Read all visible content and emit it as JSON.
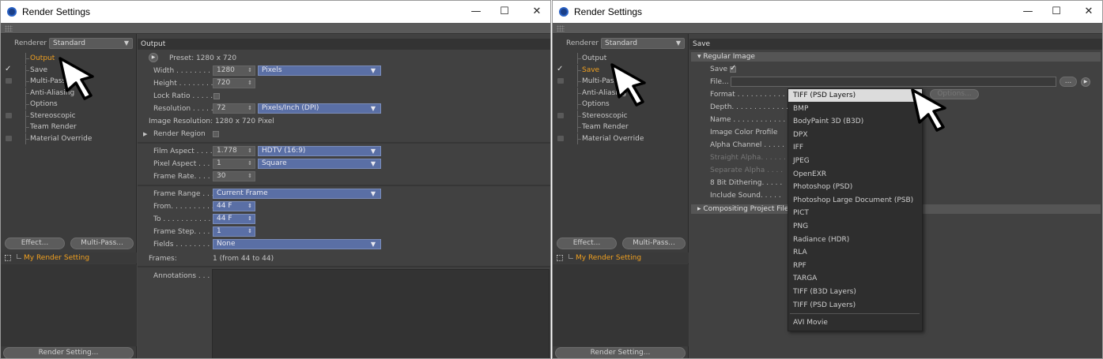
{
  "left_window": {
    "title": "Render Settings",
    "controls": {
      "minimize": "—",
      "maximize": "☐",
      "close": "✕"
    },
    "renderer_label": "Renderer",
    "renderer_value": "Standard",
    "tree": [
      {
        "label": "Output",
        "selected": true,
        "checkbox": "none"
      },
      {
        "label": "Save",
        "selected": false,
        "checkbox": "checked"
      },
      {
        "label": "Multi-Pass",
        "selected": false,
        "checkbox": "box"
      },
      {
        "label": "Anti-Aliasing",
        "selected": false,
        "checkbox": "none"
      },
      {
        "label": "Options",
        "selected": false,
        "checkbox": "none"
      },
      {
        "label": "Stereoscopic",
        "selected": false,
        "checkbox": "box"
      },
      {
        "label": "Team Render",
        "selected": false,
        "checkbox": "none"
      },
      {
        "label": "Material Override",
        "selected": false,
        "checkbox": "box"
      }
    ],
    "effect_button": "Effect...",
    "multipass_button": "Multi-Pass...",
    "render_setting_item": "My Render Setting",
    "render_setting_button": "Render Setting...",
    "panel": {
      "header": "Output",
      "preset": "Preset: 1280 x 720",
      "width_label": "Width . . . . . . . . .",
      "width_value": "1280",
      "width_unit": "Pixels",
      "height_label": "Height . . . . . . . .",
      "height_value": "720",
      "lock_ratio_label": "Lock Ratio . . . . .",
      "resolution_label": "Resolution . . . . .",
      "resolution_value": "72",
      "resolution_unit": "Pixels/Inch (DPI)",
      "image_resolution": "Image Resolution: 1280 x 720 Pixel",
      "render_region_label": "Render Region",
      "film_aspect_label": "Film Aspect . . . .",
      "film_aspect_value": "1.778",
      "film_aspect_preset": "HDTV (16:9)",
      "pixel_aspect_label": "Pixel Aspect . . . .",
      "pixel_aspect_value": "1",
      "pixel_aspect_preset": "Square",
      "frame_rate_label": "Frame Rate. . . . .",
      "frame_rate_value": "30",
      "frame_range_label": "Frame Range . . .",
      "frame_range_value": "Current Frame",
      "from_label": "From. . . . . . . . . .",
      "from_value": "44 F",
      "to_label": "To . . . . . . . . . . . .",
      "to_value": "44 F",
      "frame_step_label": "Frame Step. . . . .",
      "frame_step_value": "1",
      "fields_label": "Fields . . . . . . . . .",
      "fields_value": "None",
      "frames_label": "Frames:",
      "frames_value": "1 (from 44 to 44)",
      "annotations_label": "Annotations . . ."
    }
  },
  "right_window": {
    "title": "Render Settings",
    "controls": {
      "minimize": "—",
      "maximize": "☐",
      "close": "✕"
    },
    "renderer_label": "Renderer",
    "renderer_value": "Standard",
    "tree": [
      {
        "label": "Output",
        "selected": false,
        "checkbox": "none"
      },
      {
        "label": "Save",
        "selected": true,
        "checkbox": "checked"
      },
      {
        "label": "Multi-Pass",
        "selected": false,
        "checkbox": "box"
      },
      {
        "label": "Anti-Aliasing",
        "selected": false,
        "checkbox": "none"
      },
      {
        "label": "Options",
        "selected": false,
        "checkbox": "none"
      },
      {
        "label": "Stereoscopic",
        "selected": false,
        "checkbox": "box"
      },
      {
        "label": "Team Render",
        "selected": false,
        "checkbox": "none"
      },
      {
        "label": "Material Override",
        "selected": false,
        "checkbox": "box"
      }
    ],
    "effect_button": "Effect...",
    "multipass_button": "Multi-Pass...",
    "render_setting_item": "My Render Setting",
    "render_setting_button": "Render Setting...",
    "panel": {
      "header": "Save",
      "regular_image": "▾ Regular Image",
      "save_label": "Save",
      "file_label": "File...",
      "format_label": "Format . . . . . . . . . . . . .",
      "depth_label": "Depth. . . . . . . . . . . . . .",
      "name_label": "Name . . . . . . . . . . . . . .",
      "color_profile_label": "Image Color Profile",
      "alpha_channel_label": "Alpha Channel . . . . .",
      "straight_alpha_label": "Straight Alpha. . . . . .",
      "separate_alpha_label": "Separate Alpha . . . .",
      "dithering_label": "8 Bit Dithering. . . . .",
      "include_sound_label": "Include Sound. . . . .",
      "compositing_label": "▸ Compositing Project File",
      "options_button": "Options...",
      "more_button": "...",
      "format_menu": [
        "TIFF (PSD Layers)",
        "BMP",
        "BodyPaint 3D (B3D)",
        "DPX",
        "IFF",
        "JPEG",
        "OpenEXR",
        "Photoshop (PSD)",
        "Photoshop Large Document (PSB)",
        "PICT",
        "PNG",
        "Radiance (HDR)",
        "RLA",
        "RPF",
        "TARGA",
        "TIFF (B3D Layers)",
        "TIFF (PSD Layers)",
        "AVI Movie"
      ]
    }
  },
  "colors": {
    "accent_orange": "#f0a020",
    "highlight_blue": "#5a6fa5"
  }
}
